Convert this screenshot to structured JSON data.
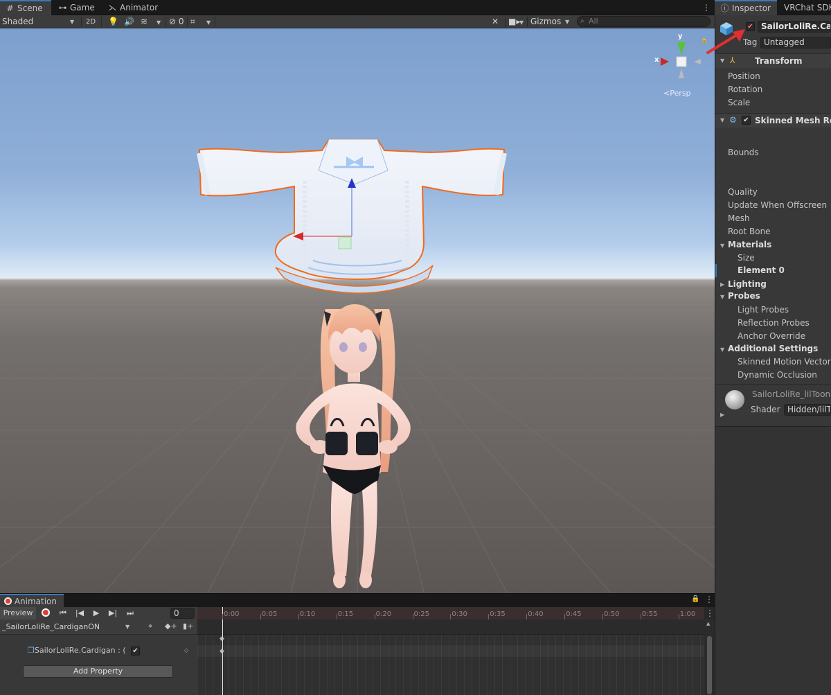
{
  "scene_tabs": [
    {
      "label": "Scene",
      "icon": "grid-icon"
    },
    {
      "label": "Game",
      "icon": "gamepad-icon"
    },
    {
      "label": "Animator",
      "icon": "animator-icon"
    }
  ],
  "scene_toolbar": {
    "shading_mode": "Shaded",
    "mode_2d": "2D",
    "hidden_count": "0",
    "gizmos_label": "Gizmos",
    "search_placeholder": "All"
  },
  "scene_view": {
    "orientation_x": "x",
    "orientation_y": "y",
    "projection_label": "Persp"
  },
  "animation": {
    "tab_label": "Animation",
    "preview_label": "Preview",
    "frame_value": "0",
    "clip_name": "_SailorLoliRe_CardiganON",
    "property_label": "SailorLoliRe.Cardigan : (",
    "property_checked": true,
    "add_property_label": "Add Property",
    "ruler_ticks": [
      "0:00",
      "0:05",
      "0:10",
      "0:15",
      "0:20",
      "0:25",
      "0:30",
      "0:35",
      "0:40",
      "0:45",
      "0:50",
      "0:55",
      "1:00"
    ]
  },
  "inspector": {
    "tabs": [
      {
        "label": "Inspector",
        "icon": "info-icon"
      },
      {
        "label": "VRChat SDK"
      }
    ],
    "object_name": "SailorLoliRe.Cardi",
    "object_active": true,
    "tag_label": "Tag",
    "tag_value": "Untagged",
    "transform": {
      "title": "Transform",
      "fields": [
        "Position",
        "Rotation",
        "Scale"
      ]
    },
    "skinned_mesh": {
      "title": "Skinned Mesh Renc",
      "enabled": true,
      "bounds_label": "Bounds",
      "fields": [
        "Quality",
        "Update When Offscreen",
        "Mesh",
        "Root Bone"
      ]
    },
    "materials": {
      "title": "Materials",
      "size_label": "Size",
      "element_label": "Element 0"
    },
    "lighting_title": "Lighting",
    "probes": {
      "title": "Probes",
      "fields": [
        "Light Probes",
        "Reflection Probes",
        "Anchor Override"
      ]
    },
    "additional": {
      "title": "Additional Settings",
      "fields": [
        "Skinned Motion Vectors",
        "Dynamic Occlusion"
      ]
    },
    "material_preview": {
      "name": "SailorLoliRe_lilToon",
      "shader_label": "Shader",
      "shader_value": "Hidden/lilTo"
    }
  },
  "colors": {
    "accent_blue": "#3a79bb",
    "record_red": "#e23b3b",
    "selection_outline": "#f26a1b",
    "annotation_arrow": "#e03030"
  }
}
